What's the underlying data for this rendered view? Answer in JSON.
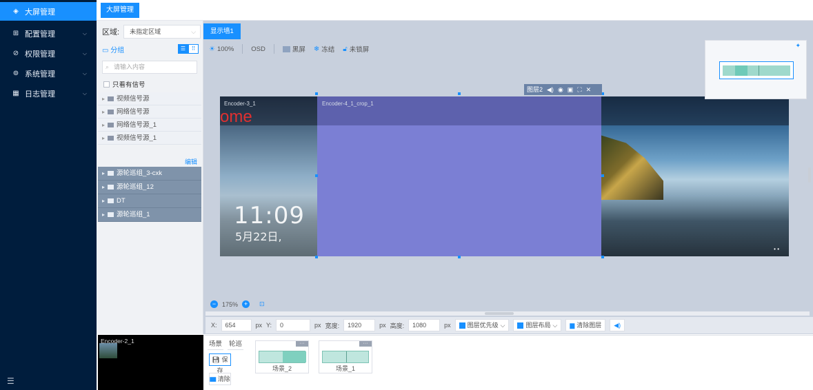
{
  "sidebar": {
    "items": [
      {
        "icon": "screen-icon",
        "label": "大屏管理",
        "active": true
      },
      {
        "icon": "config-icon",
        "label": "配置管理"
      },
      {
        "icon": "permission-icon",
        "label": "权限管理"
      },
      {
        "icon": "system-icon",
        "label": "系统管理"
      },
      {
        "icon": "log-icon",
        "label": "日志管理"
      }
    ]
  },
  "tabs": {
    "active": "大屏管理"
  },
  "left": {
    "area_label": "区域:",
    "area_value": "未指定区域",
    "group_label": "分组",
    "search_placeholder": "请输入内容",
    "only_signal": "只看有信号",
    "tree": [
      "视频信号源",
      "网络信号源",
      "网络信号源_1",
      "视频信号源_1"
    ],
    "edit": "编辑",
    "polls": [
      "源轮巡组_3-cxk",
      "源轮巡组_12",
      "DT",
      "源轮巡组_1"
    ]
  },
  "wall": {
    "tab": "显示墙1",
    "toolbar": {
      "brightness": "100%",
      "osd": "OSD",
      "black": "黑屏",
      "freeze": "冻结",
      "lock": "未锁屏"
    },
    "layer_title": "图层2",
    "enc_left": "Encoder-3_1",
    "enc_mid": "Encoder-4_1_crop_1",
    "red_text": "ome",
    "time": "11:09",
    "date": "5月22日,",
    "zoom": "175%"
  },
  "props": {
    "x_label": "X:",
    "x": "654",
    "unit1": "px",
    "y_label": "Y:",
    "y": "0",
    "unit2": "px",
    "w_label": "宽度:",
    "w": "1920",
    "unit3": "px",
    "h_label": "高度:",
    "h": "1080",
    "unit4": "px",
    "priority": "图层优先级",
    "layout": "图层布局",
    "clear": "清除图层"
  },
  "preview": {
    "label": "Encoder-2_1"
  },
  "bottom": {
    "tab1": "场景",
    "tab2": "轮巡",
    "save": "保存",
    "clear": "清除",
    "scenes": [
      "场景_2",
      "场景_1"
    ]
  }
}
